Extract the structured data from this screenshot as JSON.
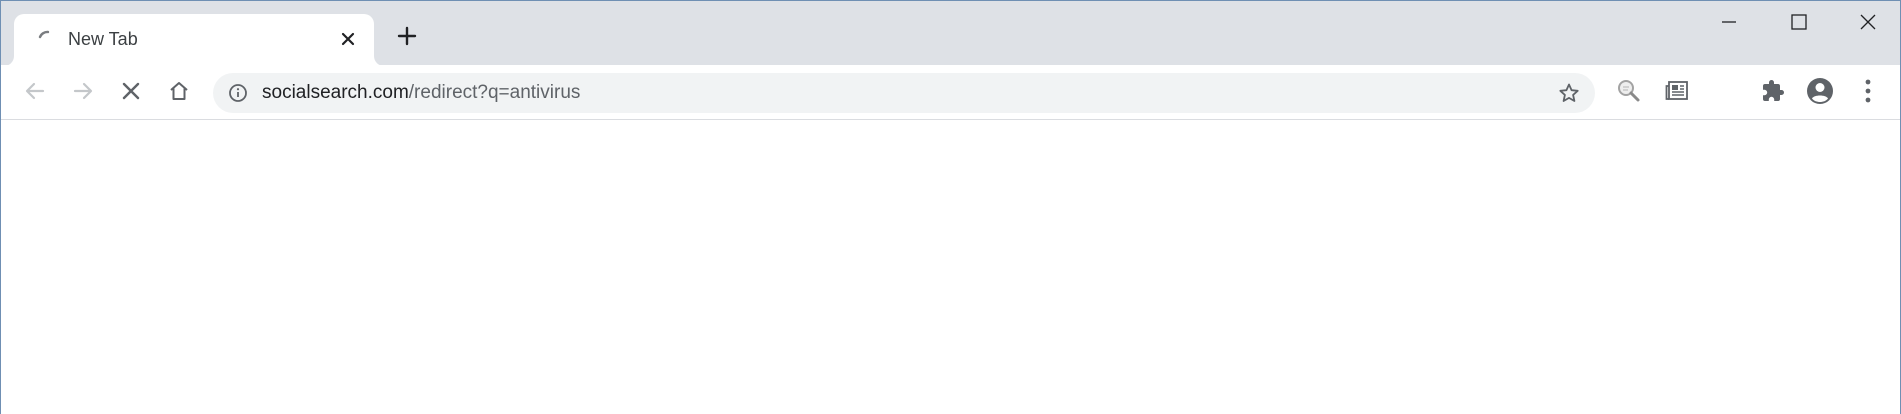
{
  "tab": {
    "title": "New Tab",
    "state": "loading"
  },
  "omnibox": {
    "url_host": "socialsearch.com",
    "url_path": "/redirect?q=antivirus"
  },
  "icons": {
    "tab_spinner": "loading-spinner-icon",
    "tab_close": "close-icon",
    "new_tab": "plus-icon",
    "minimize": "minimize-icon",
    "maximize": "maximize-icon",
    "window_close": "close-icon",
    "back": "arrow-left-icon",
    "forward": "arrow-right-icon",
    "stop": "stop-icon",
    "home": "home-icon",
    "site_info": "info-icon",
    "bookmark": "star-icon",
    "extension_search": "search-magnifier-icon",
    "extension_reader": "newspaper-icon",
    "extensions": "puzzle-icon",
    "profile": "account-circle-icon",
    "menu": "kebab-menu-icon"
  },
  "colors": {
    "tabstrip_bg": "#dee1e6",
    "omnibox_bg": "#f1f3f4",
    "icon": "#5f6368",
    "icon_disabled": "#c4c7ca",
    "window_border": "#6f8fb3"
  }
}
